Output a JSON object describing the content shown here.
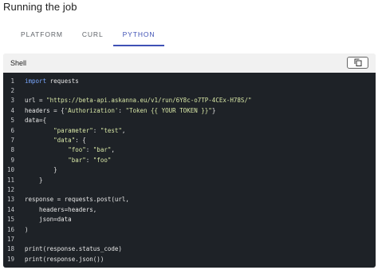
{
  "page": {
    "title": "Running the job"
  },
  "tabs": [
    {
      "label": "PLATFORM",
      "active": false
    },
    {
      "label": "CURL",
      "active": false
    },
    {
      "label": "PYTHON",
      "active": true
    }
  ],
  "panel": {
    "label": "Shell",
    "copy_icon": "copy-icon"
  },
  "colors": {
    "accent": "#3f51b5",
    "code_bg": "#1e2227",
    "keyword": "#7aa8ff",
    "string": "#d7e6a6"
  },
  "code": {
    "lines": [
      {
        "num": "1",
        "segments": [
          {
            "t": "kw",
            "v": "import"
          },
          {
            "t": "p",
            "v": " requests"
          }
        ]
      },
      {
        "num": "2",
        "segments": []
      },
      {
        "num": "3",
        "segments": [
          {
            "t": "p",
            "v": "url = "
          },
          {
            "t": "str",
            "v": "\"https://beta-api.askanna.eu/v1/run/6Y8c-o7TP-4CEx-H78S/\""
          }
        ]
      },
      {
        "num": "4",
        "segments": [
          {
            "t": "p",
            "v": "headers = {"
          },
          {
            "t": "str",
            "v": "'Authorization'"
          },
          {
            "t": "p",
            "v": ": "
          },
          {
            "t": "str",
            "v": "\"Token {{ YOUR TOKEN }}\""
          },
          {
            "t": "p",
            "v": "}"
          }
        ]
      },
      {
        "num": "5",
        "segments": [
          {
            "t": "p",
            "v": "data={"
          }
        ]
      },
      {
        "num": "6",
        "segments": [
          {
            "t": "p",
            "v": "        "
          },
          {
            "t": "str",
            "v": "\"parameter\""
          },
          {
            "t": "p",
            "v": ": "
          },
          {
            "t": "str",
            "v": "\"test\""
          },
          {
            "t": "p",
            "v": ","
          }
        ]
      },
      {
        "num": "7",
        "segments": [
          {
            "t": "p",
            "v": "        "
          },
          {
            "t": "str",
            "v": "\"data\""
          },
          {
            "t": "p",
            "v": ": {"
          }
        ]
      },
      {
        "num": "8",
        "segments": [
          {
            "t": "p",
            "v": "            "
          },
          {
            "t": "str",
            "v": "\"foo\""
          },
          {
            "t": "p",
            "v": ": "
          },
          {
            "t": "str",
            "v": "\"bar\""
          },
          {
            "t": "p",
            "v": ","
          }
        ]
      },
      {
        "num": "9",
        "segments": [
          {
            "t": "p",
            "v": "            "
          },
          {
            "t": "str",
            "v": "\"bar\""
          },
          {
            "t": "p",
            "v": ": "
          },
          {
            "t": "str",
            "v": "\"foo\""
          }
        ]
      },
      {
        "num": "10",
        "segments": [
          {
            "t": "p",
            "v": "        }"
          }
        ]
      },
      {
        "num": "11",
        "segments": [
          {
            "t": "p",
            "v": "    }"
          }
        ]
      },
      {
        "num": "12",
        "segments": []
      },
      {
        "num": "13",
        "segments": [
          {
            "t": "p",
            "v": "response = requests.post(url,"
          }
        ]
      },
      {
        "num": "14",
        "segments": [
          {
            "t": "p",
            "v": "    headers=headers,"
          }
        ]
      },
      {
        "num": "15",
        "segments": [
          {
            "t": "p",
            "v": "    json=data"
          }
        ]
      },
      {
        "num": "16",
        "segments": [
          {
            "t": "p",
            "v": ")"
          }
        ]
      },
      {
        "num": "17",
        "segments": []
      },
      {
        "num": "18",
        "segments": [
          {
            "t": "p",
            "v": "print(response.status_code)"
          }
        ]
      },
      {
        "num": "19",
        "segments": [
          {
            "t": "p",
            "v": "print(response.json())"
          }
        ]
      }
    ]
  }
}
